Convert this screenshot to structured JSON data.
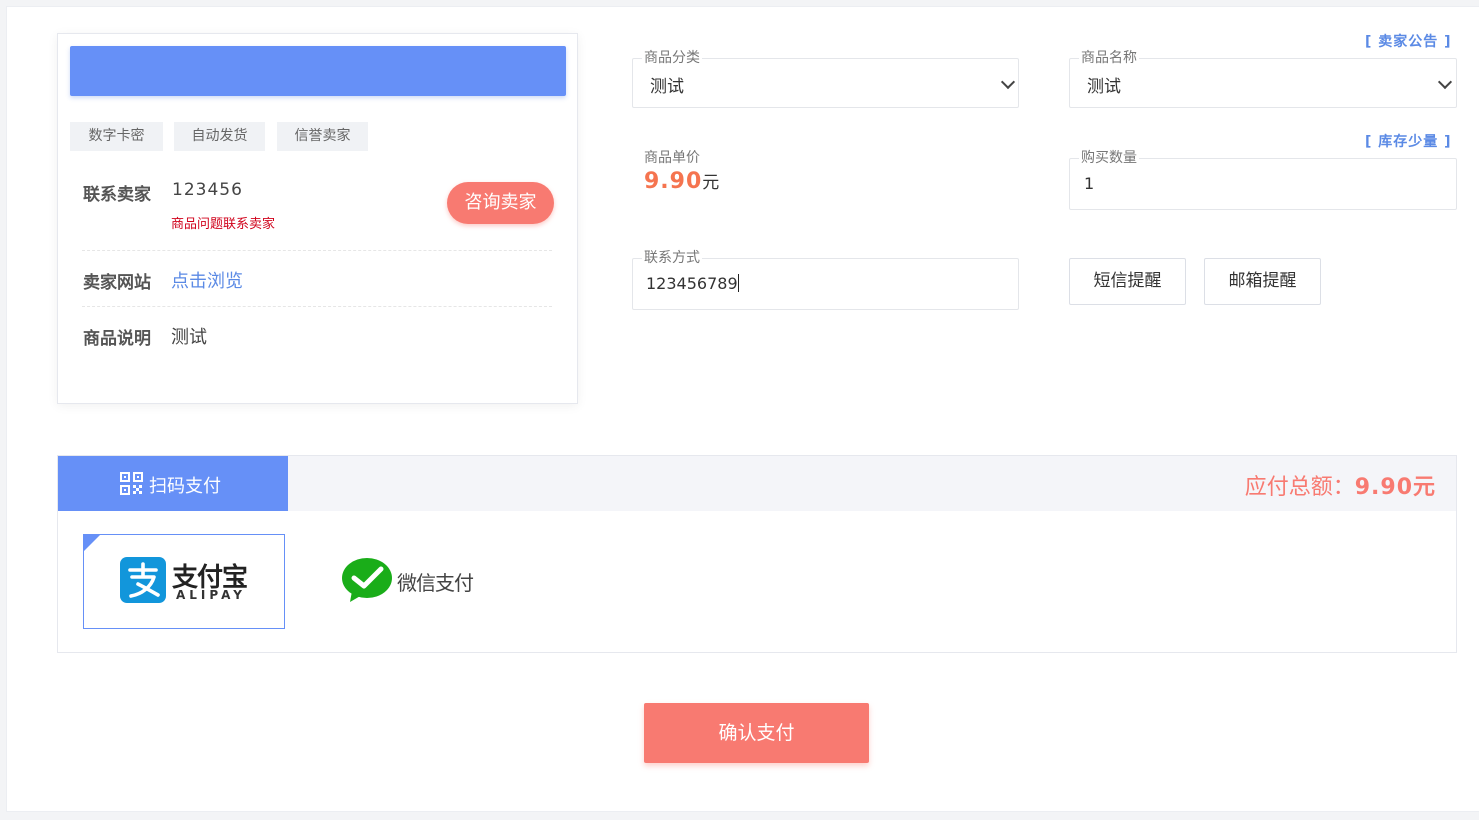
{
  "seller": {
    "tags": [
      "数字卡密",
      "自动发货",
      "信誉卖家"
    ],
    "contact_label": "联系卖家",
    "contact_value": "123456",
    "contact_note": "商品问题联系卖家",
    "consult_button": "咨询卖家",
    "website_label": "卖家网站",
    "website_link": "点击浏览",
    "desc_label": "商品说明",
    "desc_value": "测试"
  },
  "form": {
    "category_label": "商品分类",
    "category_value": "测试",
    "name_label": "商品名称",
    "name_value": "测试",
    "seller_notice": "[ 卖家公告 ]",
    "price_label": "商品单价",
    "price_value": "9.90",
    "price_unit": "元",
    "qty_label": "购买数量",
    "qty_value": "1",
    "stock_notice": "[ 库存少量 ]",
    "contact_label": "联系方式",
    "contact_value": "123456789",
    "sms_button": "短信提醒",
    "email_button": "邮箱提醒"
  },
  "payment": {
    "scan_tab": "扫码支付",
    "total_label": "应付总额：",
    "total_value": "9.90元",
    "alipay_cn": "支付宝",
    "alipay_en": "ALIPAY",
    "wechat_label": "微信支付"
  },
  "confirm_button": "确认支付",
  "colors": {
    "primary": "#6690f7",
    "accent": "#f87a71",
    "price": "#f5744f",
    "link": "#5b8ae5",
    "note_red": "#d0021b"
  },
  "icons": {
    "qr": "qr-code-icon",
    "alipay": "alipay-logo-icon",
    "wechat": "wechat-pay-logo-icon",
    "select": "chevron-down-icon"
  }
}
